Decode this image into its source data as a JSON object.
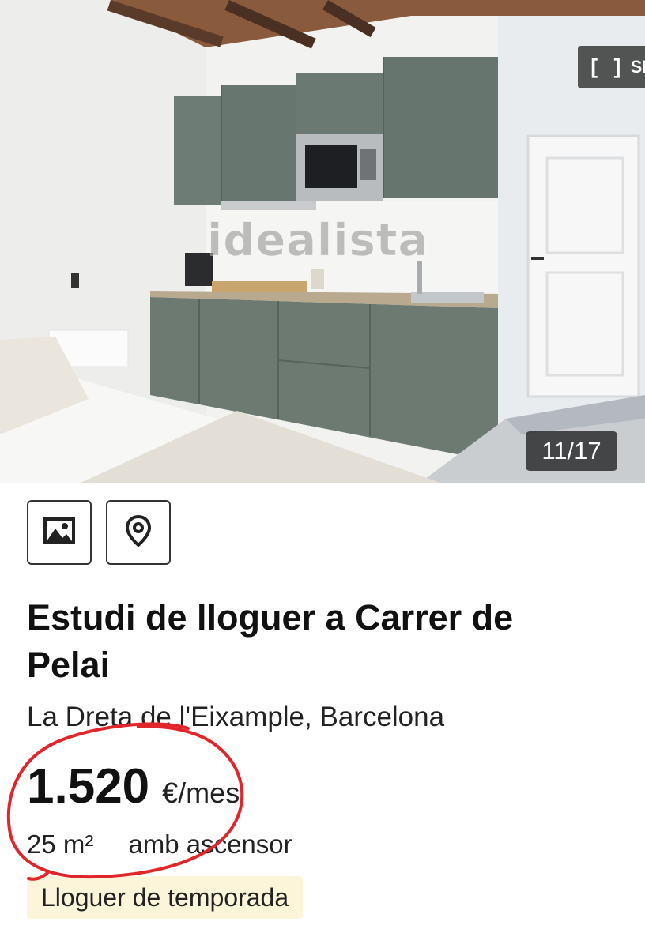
{
  "gallery": {
    "watermark": "idealista",
    "expand_label": "SP",
    "counter": "11/17"
  },
  "actions": {
    "photos_icon": "image-icon",
    "map_icon": "location-pin-icon"
  },
  "listing": {
    "title": "Estudi de lloguer a Carrer de Pelai",
    "location": "La Dreta de l'Eixample, Barcelona",
    "price": "1.520",
    "price_unit": "€/mes",
    "size": "25 m²",
    "elevator": "amb ascensor",
    "tag": "Lloguer de temporada"
  },
  "colors": {
    "cabinet_green": "#6b7a72",
    "tag_background": "#fdf5da",
    "annotation_red": "#e0262b"
  }
}
